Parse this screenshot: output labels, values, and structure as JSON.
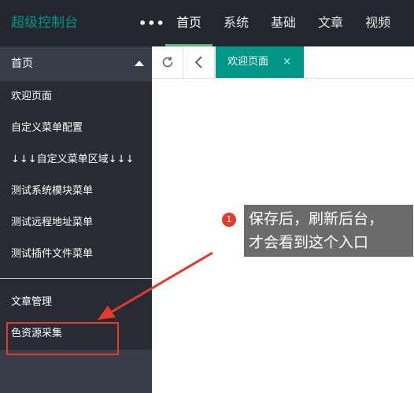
{
  "header": {
    "logo": "超级控制台",
    "more": "•••",
    "nav": [
      "首页",
      "系统",
      "基础",
      "文章",
      "视频"
    ]
  },
  "sidebar": {
    "group_title": "首页",
    "items": [
      "欢迎页面",
      "自定义菜单配置",
      "↓↓↓自定义菜单区域↓↓↓",
      "测试系统模块菜单",
      "测试远程地址菜单",
      "测试插件文件菜单"
    ],
    "bottom_items": [
      "文章管理",
      "色资源采集"
    ]
  },
  "tabs": {
    "active_label": "欢迎页面",
    "close": "×"
  },
  "annotation": {
    "badge": "1",
    "line1": "保存后，刷新后台，",
    "line2": "才会看到这个入口"
  },
  "colors": {
    "accent": "#009688",
    "highlight": "#e23a2c"
  }
}
